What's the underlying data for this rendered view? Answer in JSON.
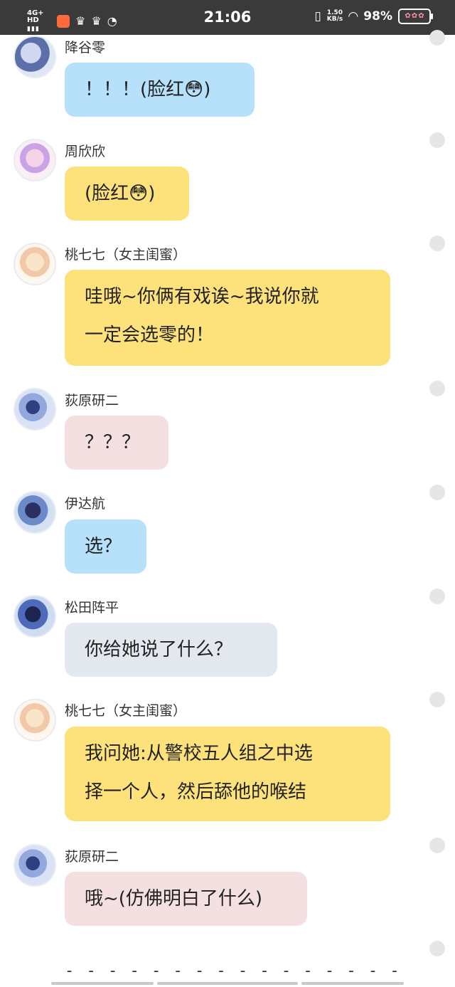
{
  "status_bar": {
    "network": "4G+ HD",
    "signal": "▮▮▮",
    "time": "21:06",
    "net_speed_value": "1.50",
    "net_speed_unit": "KB/s",
    "battery_percent": "98%"
  },
  "messages": [
    {
      "sender": "降谷零",
      "text": "！！！(脸红😳)",
      "color": "blue"
    },
    {
      "sender": "周欣欣",
      "text": "(脸红😳)",
      "color": "yellow"
    },
    {
      "sender": "桃七七（女主闺蜜）",
      "lines": [
        "哇哦~你俩有戏诶~我说你就",
        "一定会选零的！"
      ],
      "color": "yellow"
    },
    {
      "sender": "荻原研二",
      "text": "？？？",
      "color": "pink"
    },
    {
      "sender": "伊达航",
      "text": "选？",
      "color": "blue"
    },
    {
      "sender": "松田阵平",
      "text": "你给她说了什么？",
      "color": "gray"
    },
    {
      "sender": "桃七七（女主闺蜜）",
      "lines": [
        "我问她:从警校五人组之中选",
        "择一个人，然后舔他的喉结"
      ],
      "color": "yellow"
    },
    {
      "sender": "荻原研二",
      "text": "哦~(仿佛明白了什么)",
      "color": "pink"
    }
  ],
  "divider_text": "- - - - - - - - - - - - - - - - - - - - - - - - - - - - - - - - -"
}
